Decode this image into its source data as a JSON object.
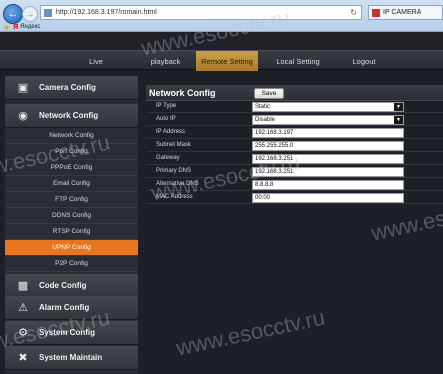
{
  "browser": {
    "url": "http://192.168.3.197/romain.html",
    "tab_title": "IP CAMERA",
    "bookmark": "Яндекс",
    "bookmark_logo": "Я"
  },
  "topnav": {
    "items": [
      {
        "label": "Live"
      },
      {
        "label": "playback"
      },
      {
        "label": "Remote Setting",
        "active": true
      },
      {
        "label": "Local Setting"
      },
      {
        "label": "Logout"
      }
    ]
  },
  "sidebar": {
    "camera_config": "Camera Config",
    "network_config": "Network Config",
    "sub_items": [
      {
        "label": "Network Config"
      },
      {
        "label": "Port Config"
      },
      {
        "label": "PPPoE Config"
      },
      {
        "label": "Email Config"
      },
      {
        "label": "FTP Config"
      },
      {
        "label": "DDNS Config"
      },
      {
        "label": "RTSP Config"
      },
      {
        "label": "UPNP Config",
        "active": true
      },
      {
        "label": "P2P Config"
      }
    ],
    "code_config": "Code Config",
    "alarm_config": "Alarm Config",
    "system_config": "System Config",
    "system_maintain": "System Maintain"
  },
  "main": {
    "title": "Network Config",
    "save_label": "Save",
    "fields": [
      {
        "label": "IP Type",
        "value": "Static",
        "type": "select"
      },
      {
        "label": "Auto IP",
        "value": "Disable",
        "type": "select"
      },
      {
        "label": "IP Address",
        "value": "192.168.3.197",
        "type": "text"
      },
      {
        "label": "Subnet Mask",
        "value": "255.255.255.0",
        "type": "text"
      },
      {
        "label": "Gateway",
        "value": "192.168.3.251",
        "type": "text"
      },
      {
        "label": "Primary DNS",
        "value": "192.168.3.251",
        "type": "text"
      },
      {
        "label": "Alternative DNS",
        "value": "8.8.8.8",
        "type": "text"
      },
      {
        "label": "MAC Address",
        "value": "00:00",
        "type": "text"
      }
    ]
  },
  "watermark": "www.esocctv.ru",
  "colors": {
    "accent_orange": "#e8761e",
    "active_tab_gold": "#c9a24a",
    "background": "#1e2028"
  },
  "icons": {
    "camera": "camera-icon",
    "network": "network-icon",
    "code": "film-icon",
    "alarm": "alarm-icon",
    "system": "gear-icon",
    "maintain": "tools-icon"
  }
}
